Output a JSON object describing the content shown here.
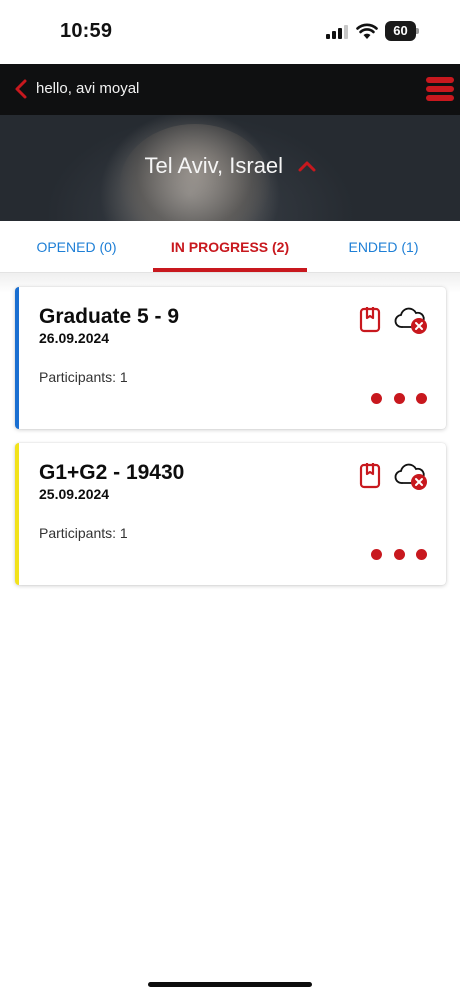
{
  "status_bar": {
    "time": "10:59",
    "battery": "60"
  },
  "header": {
    "greeting": "hello, avi moyal",
    "location": "Tel Aviv, Israel"
  },
  "tabs": [
    {
      "label": "OPENED (0)"
    },
    {
      "label": "IN PROGRESS (2)"
    },
    {
      "label": "ENDED (1)"
    }
  ],
  "cards": [
    {
      "title": "Graduate 5 - 9",
      "date": "26.09.2024",
      "participants": "Participants: 1",
      "stripe_color": "#1a6fd1"
    },
    {
      "title": "G1+G2 - 19430",
      "date": "25.09.2024",
      "participants": "Participants: 1",
      "stripe_color": "#f2e21b"
    }
  ],
  "colors": {
    "accent": "#c8181e",
    "link": "#1e7fd6"
  },
  "icons": [
    "chevron-left-icon",
    "hamburger-menu-icon",
    "chevron-up-icon",
    "clipboard-icon",
    "cloud-error-icon",
    "more-dots-icon"
  ]
}
